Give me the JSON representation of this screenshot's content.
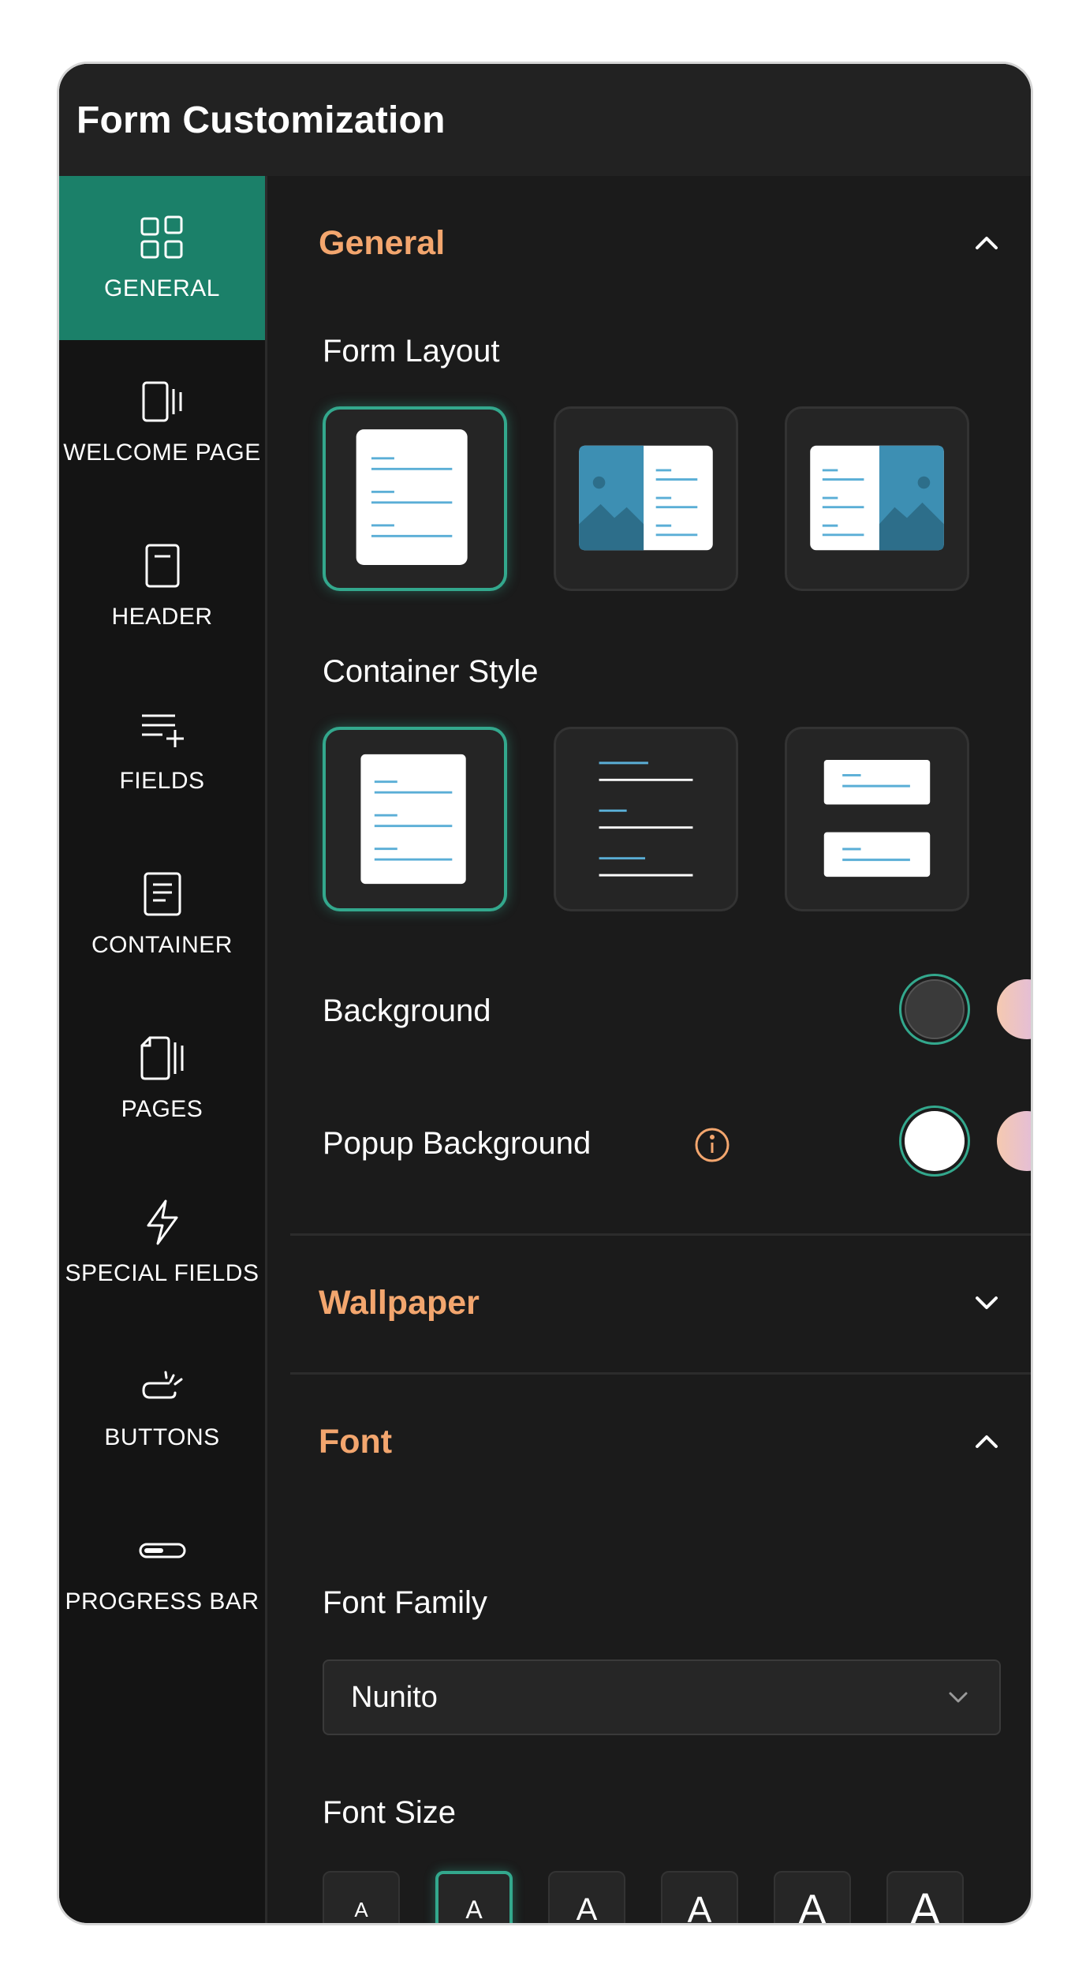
{
  "panel": {
    "title": "Form Customization"
  },
  "sidebar": {
    "items": [
      {
        "label": "GENERAL",
        "icon": "grid-icon",
        "active": true
      },
      {
        "label": "WELCOME PAGE",
        "icon": "welcome-page-icon"
      },
      {
        "label": "HEADER",
        "icon": "header-icon"
      },
      {
        "label": "FIELDS",
        "icon": "fields-icon"
      },
      {
        "label": "CONTAINER",
        "icon": "container-icon"
      },
      {
        "label": "PAGES",
        "icon": "pages-icon"
      },
      {
        "label": "SPECIAL FIELDS",
        "icon": "lightning-icon"
      },
      {
        "label": "BUTTONS",
        "icon": "button-click-icon"
      },
      {
        "label": "PROGRESS BAR",
        "icon": "progress-bar-icon"
      }
    ]
  },
  "general": {
    "title": "General",
    "expanded": true,
    "form_layout_label": "Form Layout",
    "form_layouts": [
      "full-form",
      "image-left",
      "image-right"
    ],
    "form_layout_selected": 0,
    "container_style_label": "Container Style",
    "container_styles": [
      "card",
      "underline",
      "split-cards"
    ],
    "container_style_selected": 0,
    "background_label": "Background",
    "background_colors": [
      "#3a3a3a",
      "gradient-lavender-peach"
    ],
    "background_selected": 0,
    "popup_background_label": "Popup Background",
    "popup_background_colors": [
      "#ffffff",
      "gradient-lavender-peach"
    ],
    "popup_background_selected": 0
  },
  "wallpaper": {
    "title": "Wallpaper",
    "expanded": false
  },
  "font": {
    "title": "Font",
    "expanded": true,
    "family_label": "Font Family",
    "family_value": "Nunito",
    "size_label": "Font Size",
    "sizes": [
      "A",
      "A",
      "A",
      "A",
      "A",
      "A"
    ],
    "size_selected": 1
  },
  "colors": {
    "accent": "#1b8069",
    "highlight": "#33a88d",
    "section_title": "#f3a66e"
  }
}
